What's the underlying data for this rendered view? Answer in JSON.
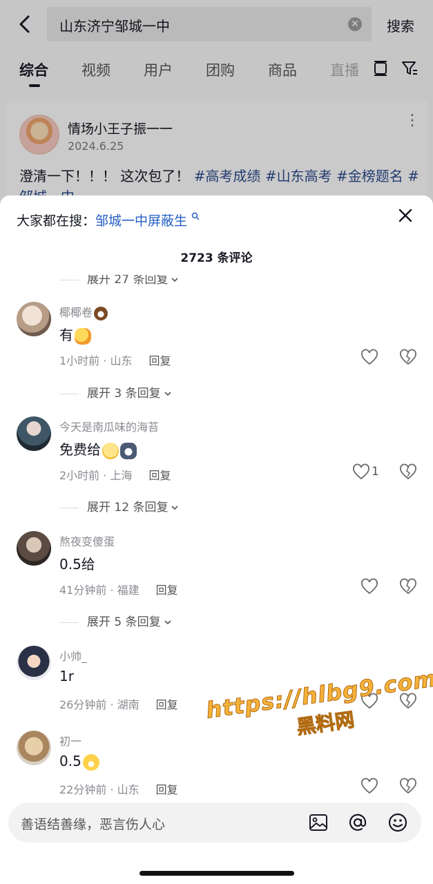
{
  "search": {
    "query": "山东济宁邹城一中",
    "button_label": "搜索"
  },
  "tabs": [
    {
      "label": "综合",
      "active": true
    },
    {
      "label": "视频",
      "active": false
    },
    {
      "label": "用户",
      "active": false
    },
    {
      "label": "团购",
      "active": false
    },
    {
      "label": "商品",
      "active": false
    },
    {
      "label": "直播",
      "active": false
    }
  ],
  "post": {
    "author": "情场小王子振一一",
    "date": "2024.6.25",
    "text_plain": "澄清一下！！！ 这次包了！",
    "hashtags": [
      "#高考成绩",
      "#山东高考",
      "#金榜题名",
      "#"
    ],
    "text_line2": "邹城一中"
  },
  "sheet": {
    "hot_search_label": "大家都在搜：",
    "hot_search_link": "邹城一中屏蔽生",
    "comment_count": "2723 条评论",
    "expand_top": "展开 27 条回复"
  },
  "comments": [
    {
      "name": "椰椰卷",
      "name_emoji": "coconut-emoji",
      "text": "有",
      "text_emoji": "fist-emoji",
      "time": "1小时前 · 山东",
      "reply_label": "回复",
      "likes": "",
      "expand": "展开 3 条回复"
    },
    {
      "name": "今天是南瓜味的海苔",
      "name_emoji": "",
      "text": "免费给",
      "text_emoji": "eyeroll-cat-emoji",
      "time": "2小时前 · 上海",
      "reply_label": "回复",
      "likes": "1",
      "expand": "展开 12 条回复"
    },
    {
      "name": "熬夜变傻蛋",
      "name_emoji": "",
      "text": "0.5给",
      "text_emoji": "",
      "time": "41分钟前 · 福建",
      "reply_label": "回复",
      "likes": "",
      "expand": "展开 5 条回复"
    },
    {
      "name": "小帅_",
      "name_emoji": "",
      "text": "1r",
      "text_emoji": "",
      "time": "26分钟前 · 湖南",
      "reply_label": "回复",
      "likes": "",
      "expand": ""
    },
    {
      "name": "初一",
      "name_emoji": "",
      "text": "0.5",
      "text_emoji": "grin-emoji",
      "time": "22分钟前 · 山东",
      "reply_label": "回复",
      "likes": "",
      "expand": ""
    }
  ],
  "input": {
    "placeholder": "善语结善缘，恶言伤人心"
  },
  "watermark": {
    "url": "https://hlbg9.com",
    "name": "黑料网"
  },
  "colors": {
    "link": "#2660c4",
    "hashtag": "#2d4a8a",
    "watermark": "#f6b23a"
  }
}
